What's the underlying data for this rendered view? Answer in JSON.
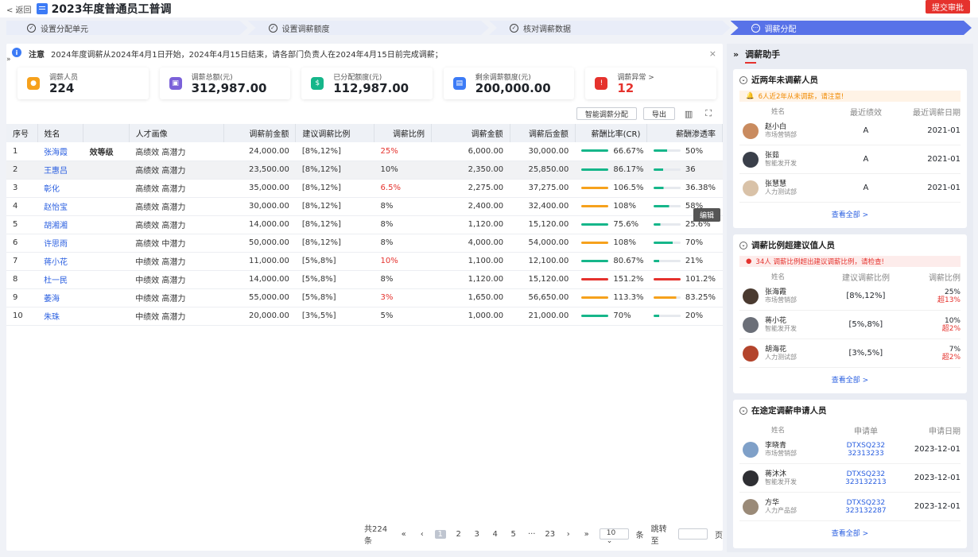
{
  "header": {
    "back": "< 返回",
    "title": "2023年度普通员工普调",
    "submit": "提交审批"
  },
  "steps": [
    "设置分配单元",
    "设置调薪额度",
    "核对调薪数据",
    "调薪分配"
  ],
  "notice": {
    "label": "注意",
    "text": "2024年度调薪从2024年4月1日开始，2024年4月15日结束，请各部门负责人在2024年4月15日前完成调薪；",
    "close": "×"
  },
  "cards": [
    {
      "label": "调薪人员",
      "value": "224",
      "color": "#f6a11c",
      "icon": "people-icon"
    },
    {
      "label": "调薪总额(元)",
      "value": "312,987.00",
      "color": "#7b61d9",
      "icon": "wallet-icon"
    },
    {
      "label": "已分配额度(元)",
      "value": "112,987.00",
      "color": "#16b68a",
      "icon": "money-icon"
    },
    {
      "label": "剩余调薪额度(元)",
      "value": "200,000.00",
      "color": "#3c7bf6",
      "icon": "card-icon"
    },
    {
      "label": "调薪异常 >",
      "value": "12",
      "color": "#e5322d",
      "icon": "warning-icon"
    }
  ],
  "toolbar": {
    "smart": "智能调薪分配",
    "export": "导出"
  },
  "table": {
    "headers": [
      "序号",
      "姓名",
      "",
      "人才画像",
      "调薪前金额",
      "建议调薪比例",
      "调薪比例",
      "调薪金额",
      "调薪后金额",
      "薪酬比率(CR)",
      "薪酬渗透率"
    ],
    "overlay": "效等级",
    "edit": "编辑",
    "rows": [
      [
        "1",
        "张海霞",
        "高绩效 高潜力",
        "24,000.00",
        "[8%,12%]",
        "25%",
        "6,000.00",
        "30,000.00",
        "66.67%",
        "50%"
      ],
      [
        "2",
        "王惠吕",
        "高绩效 高潜力",
        "23,500.00",
        "[8%,12%]",
        "10%",
        "2,350.00",
        "25,850.00",
        "86.17%",
        "36"
      ],
      [
        "3",
        "彰化",
        "高绩效 高潜力",
        "35,000.00",
        "[8%,12%]",
        "6.5%",
        "2,275.00",
        "37,275.00",
        "106.5%",
        "36.38%"
      ],
      [
        "4",
        "赵怡宝",
        "高绩效 高潜力",
        "30,000.00",
        "[8%,12%]",
        "8%",
        "2,400.00",
        "32,400.00",
        "108%",
        "58%"
      ],
      [
        "5",
        "胡湘湘",
        "高绩效 高潜力",
        "14,000.00",
        "[8%,12%]",
        "8%",
        "1,120.00",
        "15,120.00",
        "75.6%",
        "25.6%"
      ],
      [
        "6",
        "许思雨",
        "高绩效 中潜力",
        "50,000.00",
        "[8%,12%]",
        "8%",
        "4,000.00",
        "54,000.00",
        "108%",
        "70%"
      ],
      [
        "7",
        "蒋小花",
        "中绩效 高潜力",
        "11,000.00",
        "[5%,8%]",
        "10%",
        "1,100.00",
        "12,100.00",
        "80.67%",
        "21%"
      ],
      [
        "8",
        "杜一民",
        "中绩效 高潜力",
        "14,000.00",
        "[5%,8%]",
        "8%",
        "1,120.00",
        "15,120.00",
        "151.2%",
        "101.2%"
      ],
      [
        "9",
        "萎海",
        "中绩效 高潜力",
        "55,000.00",
        "[5%,8%]",
        "3%",
        "1,650.00",
        "56,650.00",
        "113.3%",
        "83.25%"
      ],
      [
        "10",
        "朱珠",
        "中绩效 高潜力",
        "20,000.00",
        "[3%,5%]",
        "5%",
        "1,000.00",
        "21,000.00",
        "70%",
        "20%"
      ]
    ]
  },
  "pager": {
    "total": "共224条",
    "pages": [
      "1",
      "2",
      "3",
      "4",
      "5",
      "···",
      "23"
    ],
    "size": "10",
    "unit": "条",
    "jump": "跳转至",
    "page": "页"
  },
  "side": {
    "title": "调薪助手",
    "p1": {
      "title": "近两年未调薪人员",
      "warn": "6人近2年从未调薪，请注意!",
      "cols": [
        "姓名",
        "最近绩效",
        "最近调薪日期"
      ],
      "rows": [
        [
          "赵小白",
          "市场营销部",
          "A",
          "2021-01"
        ],
        [
          "张茹",
          "智能发开发",
          "A",
          "2021-01"
        ],
        [
          "张慧慧",
          "人力测试部",
          "A",
          "2021-01"
        ]
      ],
      "more": "查看全部 >"
    },
    "p2": {
      "title": "调薪比例超建议值人员",
      "warn": "34人 调薪比例超出建议调薪比例，请检查!",
      "cols": [
        "姓名",
        "建议调薪比例",
        "调薪比例"
      ],
      "rows": [
        [
          "张海霞",
          "市场营销部",
          "[8%,12%]",
          "25%",
          "超13%"
        ],
        [
          "蒋小花",
          "智能发开发",
          "[5%,8%]",
          "10%",
          "超2%"
        ],
        [
          "胡海花",
          "人力测试部",
          "[3%,5%]",
          "7%",
          "超2%"
        ]
      ],
      "more": "查看全部 >"
    },
    "p3": {
      "title": "在途定调薪申请人员",
      "cols": [
        "姓名",
        "申请单",
        "申请日期"
      ],
      "rows": [
        [
          "李晓青",
          "市场营销部",
          "DTXSQ232",
          "32313233",
          "2023-12-01"
        ],
        [
          "蒋沐沐",
          "智能发开发",
          "DTXSQ232",
          "323132213",
          "2023-12-01"
        ],
        [
          "方华",
          "人力产品部",
          "DTXSQ232",
          "323132287",
          "2023-12-01"
        ]
      ],
      "more": "查看全部 >"
    }
  }
}
